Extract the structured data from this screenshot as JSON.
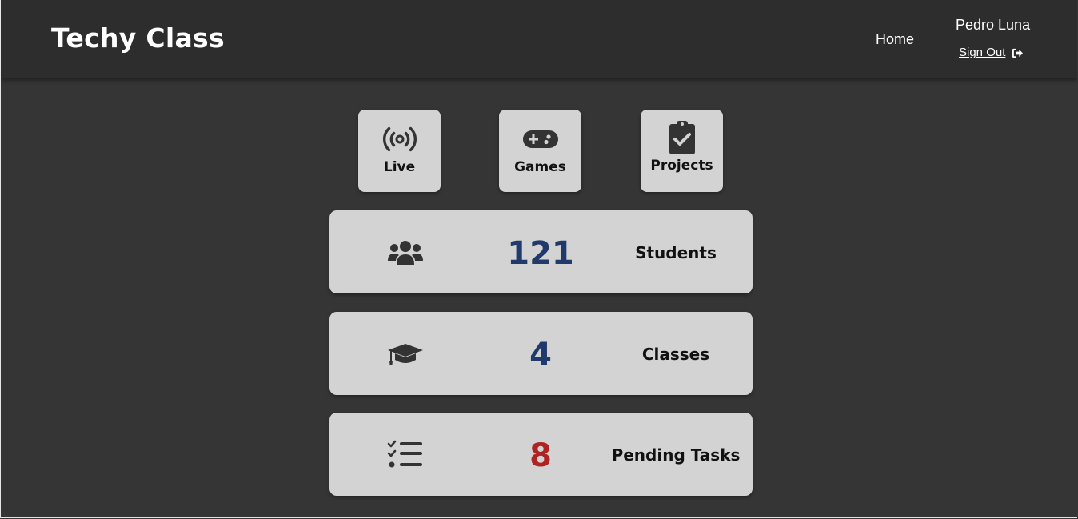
{
  "brand": {
    "title": "Techy Class"
  },
  "nav": {
    "home_label": "Home"
  },
  "user": {
    "name": "Pedro Luna",
    "signout_label": "Sign Out"
  },
  "tiles": [
    {
      "label": "Live",
      "icon": "broadcast-icon"
    },
    {
      "label": "Games",
      "icon": "gamepad-icon"
    },
    {
      "label": "Projects",
      "icon": "clipboard-check-icon"
    }
  ],
  "stats": [
    {
      "icon": "users-icon",
      "value": "121",
      "label": "Students",
      "value_color": "#1f3a6b"
    },
    {
      "icon": "graduation-cap-icon",
      "value": "4",
      "label": "Classes",
      "value_color": "#1f3a6b"
    },
    {
      "icon": "task-list-icon",
      "value": "8",
      "label": "Pending Tasks",
      "value_color": "#b02323"
    }
  ],
  "colors": {
    "background": "#353535",
    "navbar": "#2d2d2d",
    "card": "#d3d3d3",
    "count_blue": "#1f3a6b",
    "count_red": "#b02323"
  }
}
